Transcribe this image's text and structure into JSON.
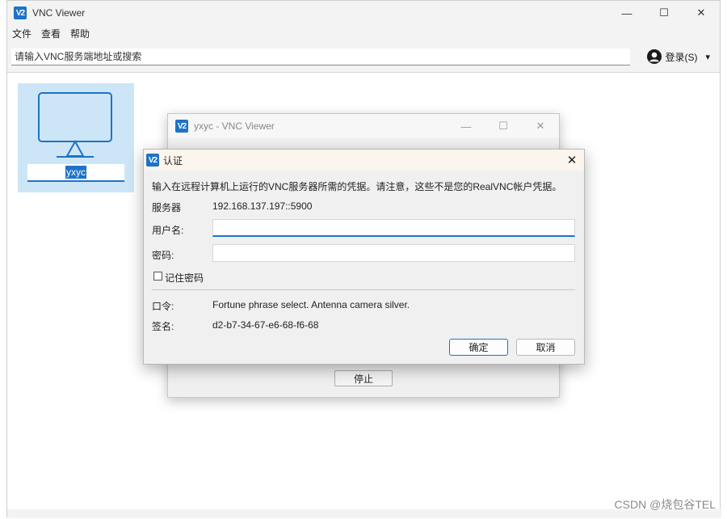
{
  "main_window": {
    "title": "VNC Viewer",
    "logo": "V2",
    "controls": {
      "minimize": "—",
      "maximize": "☐",
      "close": "✕"
    },
    "menu": [
      "文件",
      "查看",
      "帮助"
    ],
    "search": {
      "placeholder": "请输入VNC服务端地址或搜索",
      "value": ""
    },
    "signin_label": "登录(S)",
    "signin_dropdown": "▾"
  },
  "address_book": {
    "items": [
      {
        "name": "yxyc",
        "icon": "monitor-icon"
      }
    ]
  },
  "connection_window": {
    "title": "yxyc - VNC Viewer",
    "stop_label": "停止"
  },
  "auth_dialog": {
    "title": "认证",
    "close": "✕",
    "message": "输入在远程计算机上运行的VNC服务器所需的凭据。请注意，这些不是您的RealVNC帐户凭据。",
    "server_label": "服务器",
    "server_value": "192.168.137.197::5900",
    "username_label": "用户名:",
    "username_value": "",
    "password_label": "密码:",
    "password_value": "",
    "remember_label": "记住密码",
    "remember_checked": false,
    "catchphrase_label": "口令:",
    "catchphrase_value": "Fortune phrase select. Antenna camera silver.",
    "signature_label": "签名:",
    "signature_value": "d2-b7-34-67-e6-68-f6-68",
    "ok_label": "确定",
    "cancel_label": "取消"
  },
  "watermark": "CSDN @烧包谷TEL",
  "colors": {
    "accent": "#1e73c8",
    "tile_selected": "#cde6f7"
  }
}
